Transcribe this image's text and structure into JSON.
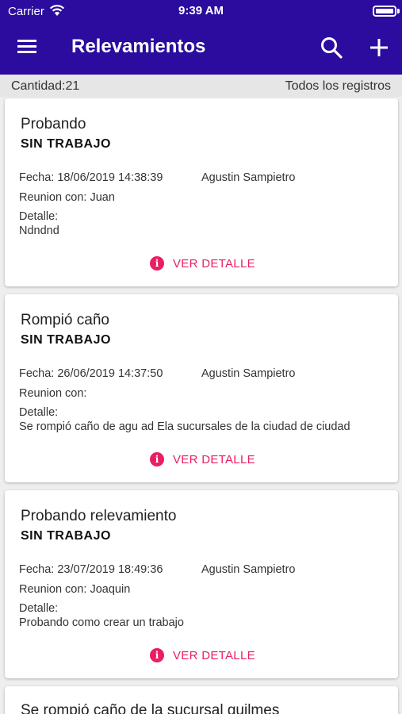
{
  "status_bar": {
    "carrier": "Carrier",
    "time": "9:39 AM"
  },
  "app_bar": {
    "title": "Relevamientos",
    "menu_icon": "menu-icon",
    "search_icon": "search-icon",
    "add_icon": "add-icon"
  },
  "subheader": {
    "count": "Cantidad:21",
    "filter": "Todos los registros"
  },
  "colors": {
    "appbar": "#2b0c9e",
    "accent": "#e91e63",
    "background": "#eeeeee"
  },
  "cards": [
    {
      "title": "Probando",
      "status": "SIN TRABAJO",
      "date": "Fecha: 18/06/2019 14:38:39",
      "user": "Agustin Sampietro",
      "meeting": "Reunion con: Juan",
      "detail_label": "Detalle:",
      "detail_text": "Ndndnd",
      "action": "VER DETALLE"
    },
    {
      "title": "Rompió caño",
      "status": "SIN TRABAJO",
      "date": "Fecha: 26/06/2019 14:37:50",
      "user": "Agustin Sampietro",
      "meeting": "Reunion con:",
      "detail_label": "Detalle:",
      "detail_text": "Se rompió caño de agu ad Ela sucursales de la ciudad de ciudad",
      "action": "VER DETALLE"
    },
    {
      "title": "Probando relevamiento",
      "status": "SIN TRABAJO",
      "date": "Fecha: 23/07/2019 18:49:36",
      "user": "Agustin Sampietro",
      "meeting": "Reunion con: Joaquin",
      "detail_label": "Detalle:",
      "detail_text": "Probando como crear un trabajo",
      "action": "VER DETALLE"
    },
    {
      "title": "Se rompió caño de la sucursal guilmes"
    }
  ]
}
